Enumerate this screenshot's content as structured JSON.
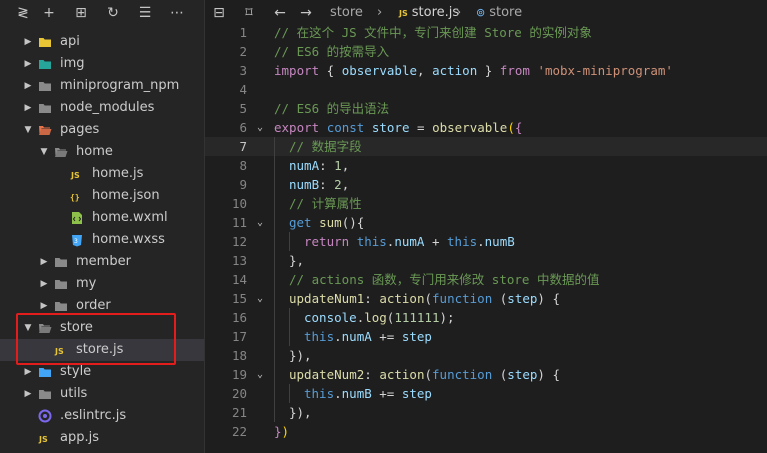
{
  "colors": {
    "accent_highlight": "#e31c1c",
    "js_icon": "#e8c534",
    "json_icon": "#e8c534",
    "wxml_icon": "#8dc149",
    "wxss_icon": "#42a5f5",
    "folder": "#8a8a8a"
  },
  "sidebar": {
    "toolbar": {
      "icons": [
        "collapse-all-icon",
        "new-file-icon",
        "new-folder-icon",
        "refresh-icon",
        "collapse-icon",
        "more-icon"
      ],
      "glyphs": [
        "≷",
        "+",
        "⊞",
        "↻",
        "☰",
        "⋯"
      ]
    },
    "items": [
      {
        "label": "api",
        "depth": 0,
        "type": "folder",
        "expanded": false,
        "icon": "folder-api-icon"
      },
      {
        "label": "img",
        "depth": 0,
        "type": "folder",
        "expanded": false,
        "icon": "folder-img-icon"
      },
      {
        "label": "miniprogram_npm",
        "depth": 0,
        "type": "folder",
        "expanded": false,
        "icon": "folder-icon"
      },
      {
        "label": "node_modules",
        "depth": 0,
        "type": "folder",
        "expanded": false,
        "icon": "folder-icon"
      },
      {
        "label": "pages",
        "depth": 0,
        "type": "folder",
        "expanded": true,
        "icon": "folder-pages-icon"
      },
      {
        "label": "home",
        "depth": 1,
        "type": "folder",
        "expanded": true,
        "icon": "folder-open-icon"
      },
      {
        "label": "home.js",
        "depth": 2,
        "type": "js",
        "icon": "js-file-icon"
      },
      {
        "label": "home.json",
        "depth": 2,
        "type": "json",
        "icon": "json-file-icon"
      },
      {
        "label": "home.wxml",
        "depth": 2,
        "type": "wxml",
        "icon": "wxml-file-icon"
      },
      {
        "label": "home.wxss",
        "depth": 2,
        "type": "wxss",
        "icon": "wxss-file-icon"
      },
      {
        "label": "member",
        "depth": 1,
        "type": "folder",
        "expanded": false,
        "icon": "folder-icon"
      },
      {
        "label": "my",
        "depth": 1,
        "type": "folder",
        "expanded": false,
        "icon": "folder-icon"
      },
      {
        "label": "order",
        "depth": 1,
        "type": "folder",
        "expanded": false,
        "icon": "folder-icon"
      },
      {
        "label": "store",
        "depth": 0,
        "type": "folder",
        "expanded": true,
        "icon": "folder-open-icon"
      },
      {
        "label": "store.js",
        "depth": 1,
        "type": "js",
        "icon": "js-file-icon",
        "active": true
      },
      {
        "label": "style",
        "depth": 0,
        "type": "folder",
        "expanded": false,
        "icon": "folder-style-icon"
      },
      {
        "label": "utils",
        "depth": 0,
        "type": "folder",
        "expanded": false,
        "icon": "folder-icon"
      },
      {
        "label": ".eslintrc.js",
        "depth": 0,
        "type": "eslint",
        "icon": "eslint-file-icon"
      },
      {
        "label": "app.js",
        "depth": 0,
        "type": "js",
        "icon": "js-file-icon"
      }
    ]
  },
  "editor": {
    "toolbar": {
      "icons": [
        "split-editor-icon",
        "bookmark-icon",
        "back-icon",
        "forward-icon"
      ],
      "glyphs": [
        "⊟",
        "⌑",
        "←",
        "→"
      ]
    },
    "breadcrumb": [
      {
        "text": "store",
        "icon": null
      },
      {
        "text": "›",
        "icon": null
      },
      {
        "text": "store.js",
        "icon": "js-file-icon"
      },
      {
        "text": "›",
        "icon": null
      },
      {
        "text": "store",
        "icon": "variable-icon"
      }
    ],
    "current_line": 7,
    "lines": [
      {
        "n": "1",
        "indent": 0,
        "fold": false,
        "tokens": [
          [
            "c-comment",
            "// 在这个 JS 文件中，专门来创建 Store 的实例对象"
          ]
        ]
      },
      {
        "n": "2",
        "indent": 0,
        "fold": false,
        "tokens": [
          [
            "c-comment",
            "// ES6 的按需导入"
          ]
        ]
      },
      {
        "n": "3",
        "indent": 0,
        "fold": false,
        "tokens": [
          [
            "c-import",
            "import"
          ],
          [
            "c-punc",
            " { "
          ],
          [
            "c-var",
            "observable"
          ],
          [
            "c-punc",
            ", "
          ],
          [
            "c-var",
            "action"
          ],
          [
            "c-punc",
            " } "
          ],
          [
            "c-import",
            "from"
          ],
          [
            "c-punc",
            " "
          ],
          [
            "c-str",
            "'mobx-miniprogram'"
          ]
        ]
      },
      {
        "n": "4",
        "indent": 0,
        "fold": false,
        "tokens": []
      },
      {
        "n": "5",
        "indent": 0,
        "fold": false,
        "tokens": [
          [
            "c-comment",
            "// ES6 的导出语法"
          ]
        ]
      },
      {
        "n": "6",
        "indent": 0,
        "fold": true,
        "tokens": [
          [
            "c-import",
            "export"
          ],
          [
            "c-punc",
            " "
          ],
          [
            "c-key",
            "const"
          ],
          [
            "c-punc",
            " "
          ],
          [
            "c-var",
            "store"
          ],
          [
            "c-punc",
            " = "
          ],
          [
            "c-fn",
            "observable"
          ],
          [
            "c-brace",
            "("
          ],
          [
            "c-import",
            "{"
          ]
        ]
      },
      {
        "n": "7",
        "indent": 1,
        "fold": false,
        "tokens": [
          [
            "c-comment",
            "// 数据字段"
          ]
        ]
      },
      {
        "n": "8",
        "indent": 1,
        "fold": false,
        "tokens": [
          [
            "c-var",
            "numA"
          ],
          [
            "c-punc",
            ": "
          ],
          [
            "c-num",
            "1"
          ],
          [
            "c-punc",
            ","
          ]
        ]
      },
      {
        "n": "9",
        "indent": 1,
        "fold": false,
        "tokens": [
          [
            "c-var",
            "numB"
          ],
          [
            "c-punc",
            ": "
          ],
          [
            "c-num",
            "2"
          ],
          [
            "c-punc",
            ","
          ]
        ]
      },
      {
        "n": "10",
        "indent": 1,
        "fold": false,
        "tokens": [
          [
            "c-comment",
            "// 计算属性"
          ]
        ]
      },
      {
        "n": "11",
        "indent": 1,
        "fold": true,
        "tokens": [
          [
            "c-key",
            "get"
          ],
          [
            "c-punc",
            " "
          ],
          [
            "c-fn",
            "sum"
          ],
          [
            "c-punc",
            "(){"
          ]
        ]
      },
      {
        "n": "12",
        "indent": 2,
        "fold": false,
        "tokens": [
          [
            "c-import",
            "return"
          ],
          [
            "c-punc",
            " "
          ],
          [
            "c-key",
            "this"
          ],
          [
            "c-punc",
            "."
          ],
          [
            "c-var",
            "numA"
          ],
          [
            "c-punc",
            " + "
          ],
          [
            "c-key",
            "this"
          ],
          [
            "c-punc",
            "."
          ],
          [
            "c-var",
            "numB"
          ]
        ]
      },
      {
        "n": "13",
        "indent": 1,
        "fold": false,
        "tokens": [
          [
            "c-punc",
            "},"
          ]
        ]
      },
      {
        "n": "14",
        "indent": 1,
        "fold": false,
        "tokens": [
          [
            "c-comment",
            "// actions 函数，专门用来修改 store 中数据的值"
          ]
        ]
      },
      {
        "n": "15",
        "indent": 1,
        "fold": true,
        "tokens": [
          [
            "c-fn",
            "updateNum1"
          ],
          [
            "c-punc",
            ": "
          ],
          [
            "c-fn",
            "action"
          ],
          [
            "c-punc",
            "("
          ],
          [
            "c-key",
            "function"
          ],
          [
            "c-punc",
            " ("
          ],
          [
            "c-var",
            "step"
          ],
          [
            "c-punc",
            ") {"
          ]
        ]
      },
      {
        "n": "16",
        "indent": 2,
        "fold": false,
        "tokens": [
          [
            "c-var",
            "console"
          ],
          [
            "c-punc",
            "."
          ],
          [
            "c-fn",
            "log"
          ],
          [
            "c-punc",
            "("
          ],
          [
            "c-num",
            "111111"
          ],
          [
            "c-punc",
            ");"
          ]
        ]
      },
      {
        "n": "17",
        "indent": 2,
        "fold": false,
        "tokens": [
          [
            "c-key",
            "this"
          ],
          [
            "c-punc",
            "."
          ],
          [
            "c-var",
            "numA"
          ],
          [
            "c-punc",
            " += "
          ],
          [
            "c-var",
            "step"
          ]
        ]
      },
      {
        "n": "18",
        "indent": 1,
        "fold": false,
        "tokens": [
          [
            "c-punc",
            "}),"
          ]
        ]
      },
      {
        "n": "19",
        "indent": 1,
        "fold": true,
        "tokens": [
          [
            "c-fn",
            "updateNum2"
          ],
          [
            "c-punc",
            ": "
          ],
          [
            "c-fn",
            "action"
          ],
          [
            "c-punc",
            "("
          ],
          [
            "c-key",
            "function"
          ],
          [
            "c-punc",
            " ("
          ],
          [
            "c-var",
            "step"
          ],
          [
            "c-punc",
            ") {"
          ]
        ]
      },
      {
        "n": "20",
        "indent": 2,
        "fold": false,
        "tokens": [
          [
            "c-key",
            "this"
          ],
          [
            "c-punc",
            "."
          ],
          [
            "c-var",
            "numB"
          ],
          [
            "c-punc",
            " += "
          ],
          [
            "c-var",
            "step"
          ]
        ]
      },
      {
        "n": "21",
        "indent": 1,
        "fold": false,
        "tokens": [
          [
            "c-punc",
            "}),"
          ]
        ]
      },
      {
        "n": "22",
        "indent": 0,
        "fold": false,
        "tokens": [
          [
            "c-import",
            "}"
          ],
          [
            "c-brace",
            ")"
          ]
        ]
      }
    ]
  }
}
